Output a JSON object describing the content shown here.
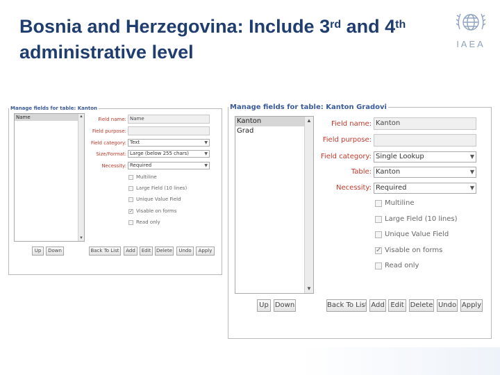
{
  "slide": {
    "title_line1_pre": "Bosnia and Herzegovina: Include 3",
    "title_sup1": "rd",
    "title_mid": " and 4",
    "title_sup2": "th",
    "title_line2": "administrative level",
    "logo_text": "IAEA"
  },
  "panels": [
    {
      "legend": "Manage fields for table: Kanton",
      "list_items": [
        {
          "label": "Name",
          "selected": true
        }
      ],
      "fields": {
        "field_name": {
          "label": "Field name:",
          "value": "Name"
        },
        "field_purpose": {
          "label": "Field purpose:",
          "value": ""
        },
        "field_category": {
          "label": "Field category:",
          "value": "Text"
        },
        "size_format": {
          "label": "Size/Format:",
          "value": "Large (below 255 chars)"
        },
        "necessity": {
          "label": "Necessity:",
          "value": "Required"
        }
      },
      "checkboxes": [
        {
          "label": "Multiline",
          "checked": false
        },
        {
          "label": "Large Field (10 lines)",
          "checked": false
        },
        {
          "label": "Unique Value Field",
          "checked": false
        },
        {
          "label": "Visable on forms",
          "checked": true
        },
        {
          "label": "Read only",
          "checked": false
        }
      ],
      "buttons": {
        "up": "Up",
        "down": "Down",
        "back": "Back To List",
        "add": "Add",
        "edit": "Edit",
        "delete": "Delete",
        "undo": "Undo",
        "apply": "Apply"
      }
    },
    {
      "legend": "Manage fields for table: Kanton Gradovi",
      "list_items": [
        {
          "label": "Kanton",
          "selected": true
        },
        {
          "label": "Grad",
          "selected": false
        }
      ],
      "fields": {
        "field_name": {
          "label": "Field name:",
          "value": "Kanton"
        },
        "field_purpose": {
          "label": "Field purpose:",
          "value": ""
        },
        "field_category": {
          "label": "Field category:",
          "value": "Single Lookup"
        },
        "table": {
          "label": "Table:",
          "value": "Kanton"
        },
        "necessity": {
          "label": "Necessity:",
          "value": "Required"
        }
      },
      "checkboxes": [
        {
          "label": "Multiline",
          "checked": false
        },
        {
          "label": "Large Field (10 lines)",
          "checked": false
        },
        {
          "label": "Unique Value Field",
          "checked": false
        },
        {
          "label": "Visable on forms",
          "checked": true
        },
        {
          "label": "Read only",
          "checked": false
        }
      ],
      "buttons": {
        "up": "Up",
        "down": "Down",
        "back": "Back To List",
        "add": "Add",
        "edit": "Edit",
        "delete": "Delete",
        "undo": "Undo",
        "apply": "Apply"
      }
    }
  ],
  "icons": {
    "logo": "un-emblem-icon",
    "scroll_up": "scroll-up-arrow-icon",
    "scroll_down": "scroll-down-arrow-icon",
    "dropdown": "chevron-down-icon",
    "checkbox_tick": "check-icon"
  },
  "colors": {
    "title": "#1f3d6e",
    "legend": "#3a5a9a",
    "field_label": "#c0392b",
    "logo": "#8fa3bf"
  }
}
